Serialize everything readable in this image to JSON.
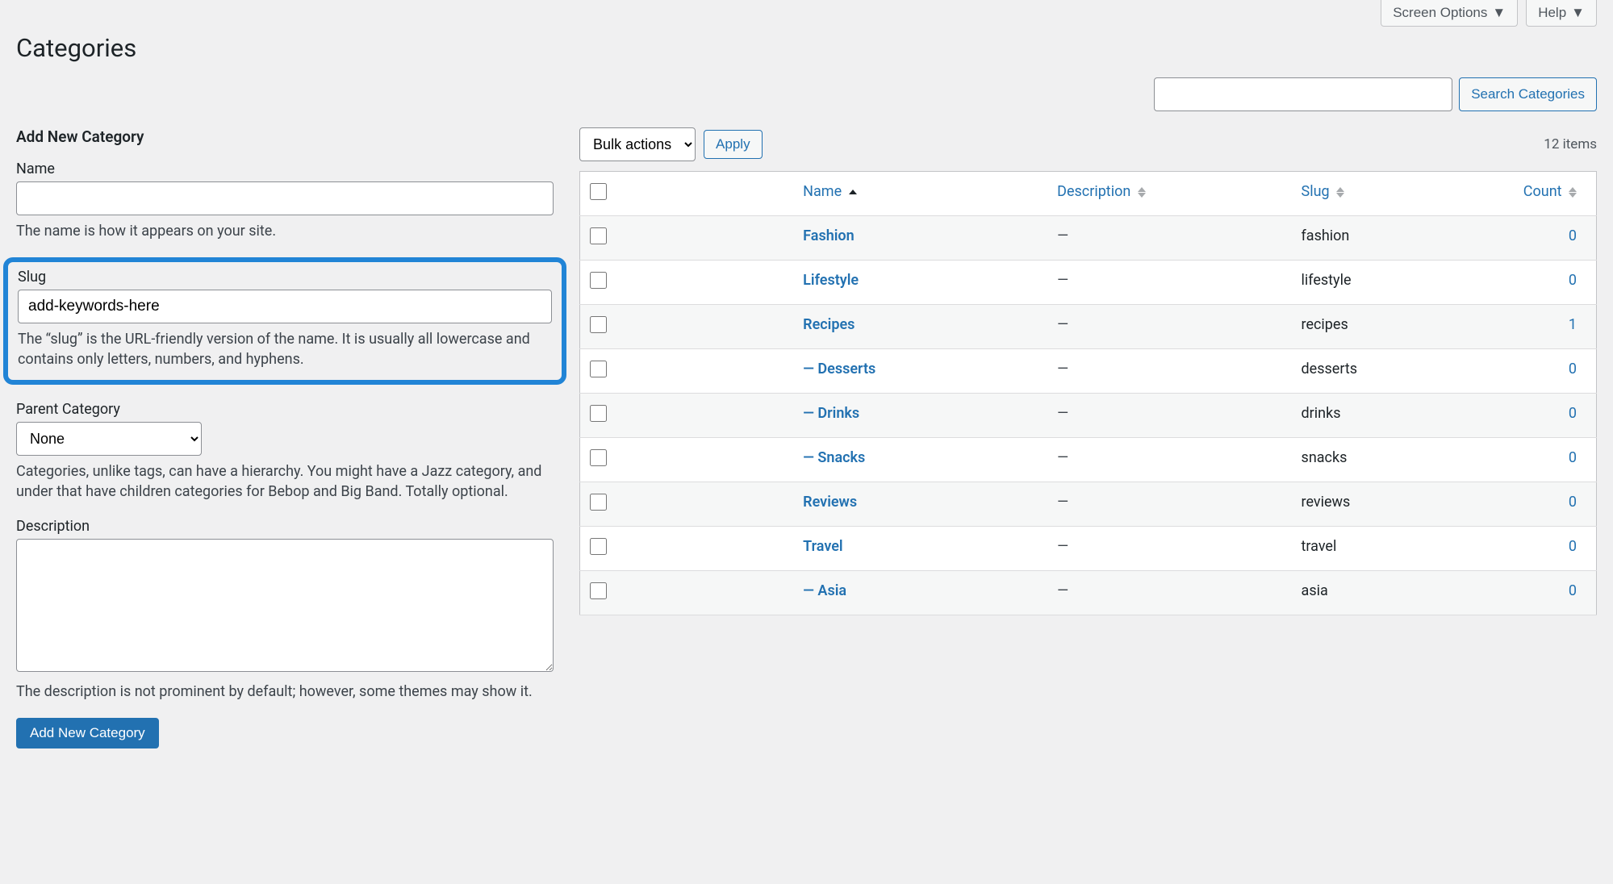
{
  "header": {
    "screen_options_label": "Screen Options",
    "help_label": "Help",
    "page_title": "Categories",
    "search_button": "Search Categories"
  },
  "form": {
    "heading": "Add New Category",
    "name_label": "Name",
    "name_help": "The name is how it appears on your site.",
    "slug_label": "Slug",
    "slug_value": "add-keywords-here",
    "slug_help": "The “slug” is the URL-friendly version of the name. It is usually all lowercase and contains only letters, numbers, and hyphens.",
    "parent_label": "Parent Category",
    "parent_value": "None",
    "parent_help": "Categories, unlike tags, can have a hierarchy. You might have a Jazz category, and under that have children categories for Bebop and Big Band. Totally optional.",
    "description_label": "Description",
    "description_help": "The description is not prominent by default; however, some themes may show it.",
    "submit_label": "Add New Category"
  },
  "table_top": {
    "bulk_actions_label": "Bulk actions",
    "apply_label": "Apply",
    "items_count": "12 items"
  },
  "columns": {
    "name": "Name",
    "description": "Description",
    "slug": "Slug",
    "count": "Count"
  },
  "rows": [
    {
      "name": "Fashion",
      "description": "—",
      "slug": "fashion",
      "count": "0"
    },
    {
      "name": "Lifestyle",
      "description": "—",
      "slug": "lifestyle",
      "count": "0"
    },
    {
      "name": "Recipes",
      "description": "—",
      "slug": "recipes",
      "count": "1"
    },
    {
      "name": "— Desserts",
      "description": "—",
      "slug": "desserts",
      "count": "0"
    },
    {
      "name": "— Drinks",
      "description": "—",
      "slug": "drinks",
      "count": "0"
    },
    {
      "name": "— Snacks",
      "description": "—",
      "slug": "snacks",
      "count": "0"
    },
    {
      "name": "Reviews",
      "description": "—",
      "slug": "reviews",
      "count": "0"
    },
    {
      "name": "Travel",
      "description": "—",
      "slug": "travel",
      "count": "0"
    },
    {
      "name": "— Asia",
      "description": "—",
      "slug": "asia",
      "count": "0"
    }
  ]
}
